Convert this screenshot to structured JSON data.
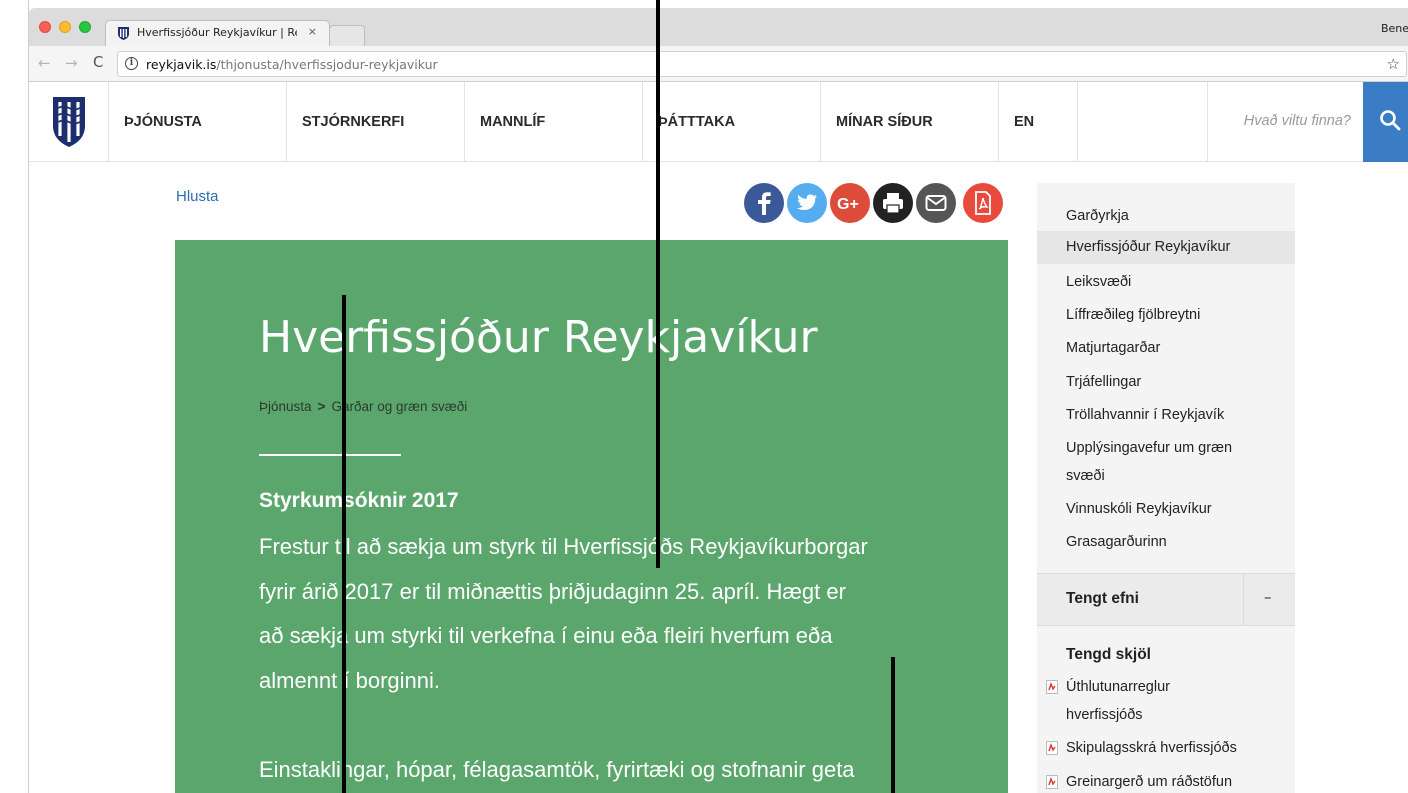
{
  "browser": {
    "tab_title": "Hverfissjóður Reykjavíkur | Rey",
    "tab_close": "×",
    "profile_name": "Bene",
    "url_host": "reykjavik.is",
    "url_path": "/thjonusta/hverfissjodur-reykjavikur",
    "back_icon": "←",
    "forward_icon": "→",
    "reload_icon": "C",
    "info_icon": "i",
    "star_icon": "☆"
  },
  "nav": {
    "items": [
      "ÞJÓNUSTA",
      "STJÓRNKERFI",
      "MANNLÍF",
      "ÞÁTTTAKA",
      "MÍNAR SÍÐUR",
      "EN"
    ],
    "search_placeholder": "Hvað viltu finna?"
  },
  "page": {
    "listen_label": "Hlusta",
    "title": "Hverfissjóður Reykjavíkur",
    "breadcrumb": [
      "Þjónusta",
      ">",
      "Garðar og græn svæði"
    ],
    "subheading": "Styrkumsóknir 2017",
    "paragraph_lines": [
      "Frestur til að sækja um styrk til Hverfissjóðs Reykjavíkurborgar",
      "fyrir árið 2017 er til miðnættis þriðjudaginn 25. apríl. Hægt er",
      "að sækja um styrki til verkefna í einu eða fleiri hverfum eða",
      "almennt í borginni."
    ],
    "paragraph2_line": "Einstaklingar, hópar, félagasamtök, fyrirtæki og stofnanir geta"
  },
  "share_icons": [
    "facebook-icon",
    "twitter-icon",
    "google-plus-icon",
    "print-icon",
    "email-icon",
    "pdf-icon"
  ],
  "share_colors": {
    "facebook": "#3b5998",
    "twitter": "#55acee",
    "google_plus": "#dd4b39",
    "print": "#222222",
    "email": "#555555",
    "pdf": "#e84b3c"
  },
  "sidebar": {
    "items": [
      "Garðyrkja",
      "Hverfissjóður Reykjavíkur",
      "Leiksvæði",
      "Líffræðileg fjölbreytni",
      "Matjurtagarðar",
      "Trjáfellingar",
      "Tröllahvannir í Reykjavík",
      "Upplýsingavefur um græn",
      "svæði",
      "Vinnuskóli Reykjavíkur",
      "Grasagarðurinn"
    ],
    "related_label": "Tengt efni",
    "related_toggle": "–",
    "docs_title": "Tengd skjöl",
    "docs": [
      "Úthlutunarreglur",
      "hverfissjóðs",
      "Skipulagsskrá hverfissjóðs",
      "Greinargerð um ráðstöfun"
    ]
  },
  "colors": {
    "hero_green": "#5ba66c",
    "search_blue": "#3b7dc4",
    "link_blue": "#2a6db1"
  }
}
